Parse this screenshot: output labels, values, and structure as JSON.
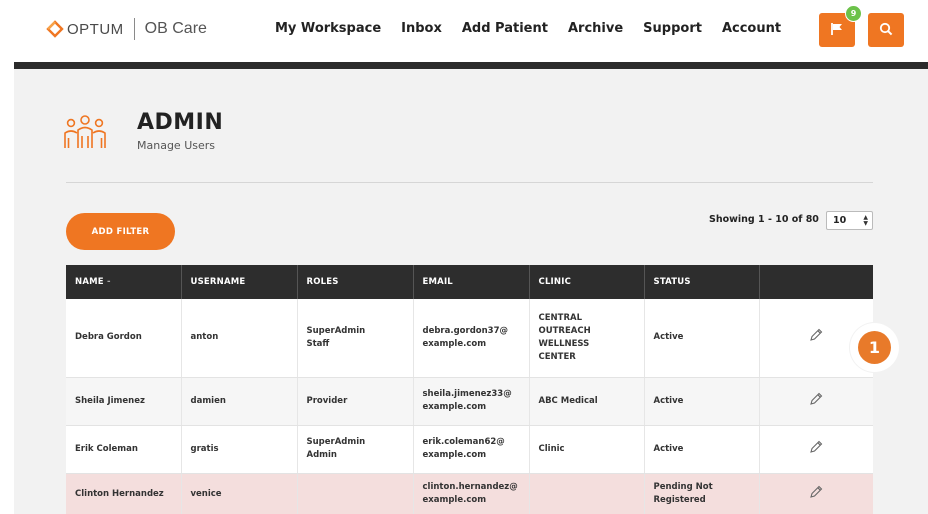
{
  "brand": {
    "company": "OPTUM",
    "product": "OB Care",
    "accent_color": "#ef7622",
    "dark_color": "#2d2d2d"
  },
  "nav": {
    "items": [
      {
        "label": "My Workspace"
      },
      {
        "label": "Inbox"
      },
      {
        "label": "Add Patient"
      },
      {
        "label": "Archive"
      },
      {
        "label": "Support"
      },
      {
        "label": "Account"
      }
    ]
  },
  "header_buttons": {
    "flag_icon": "flag-icon",
    "flag_badge_count": "9",
    "search_icon": "search-icon"
  },
  "page": {
    "title": "ADMIN",
    "subtitle": "Manage Users",
    "icon": "users-group-icon"
  },
  "toolbar": {
    "add_filter_label": "ADD FILTER",
    "showing_text": "Showing 1 - 10 of 80",
    "per_page_value": "10"
  },
  "table": {
    "columns": [
      "NAME",
      "USERNAME",
      "ROLES",
      "EMAIL",
      "CLINIC",
      "STATUS",
      ""
    ],
    "sort_indicator": "-",
    "rows": [
      {
        "name": "Debra Gordon",
        "username": "anton",
        "roles": [
          "SuperAdmin",
          "Staff"
        ],
        "email": [
          "debra.gordon37@",
          "example.com"
        ],
        "clinic": [
          "CENTRAL",
          "OUTREACH",
          "WELLNESS",
          "CENTER"
        ],
        "status": [
          "Active"
        ]
      },
      {
        "name": "Sheila Jimenez",
        "username": "damien",
        "roles": [
          "Provider"
        ],
        "email": [
          "sheila.jimenez33@",
          "example.com"
        ],
        "clinic": [
          "ABC Medical"
        ],
        "status": [
          "Active"
        ]
      },
      {
        "name": "Erik Coleman",
        "username": "gratis",
        "roles": [
          "SuperAdmin",
          "Admin"
        ],
        "email": [
          "erik.coleman62@",
          "example.com"
        ],
        "clinic": [
          "Clinic"
        ],
        "status": [
          "Active"
        ]
      },
      {
        "name": "Clinton Hernandez",
        "username": "venice",
        "roles": [],
        "email": [
          "clinton.hernandez@",
          "example.com"
        ],
        "clinic": [],
        "status": [
          "Pending Not",
          "Registered"
        ]
      }
    ],
    "edit_icon": "pencil-icon"
  },
  "step_marker": {
    "label": "1"
  }
}
